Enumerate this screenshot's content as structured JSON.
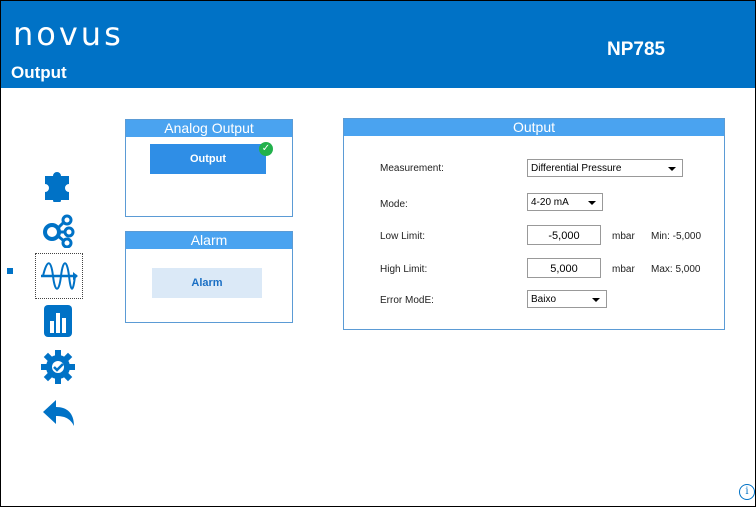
{
  "header": {
    "logo": "novus",
    "model": "NP785",
    "screen_title": "Output"
  },
  "sidebar": {
    "items": [
      {
        "icon": "puzzle-icon"
      },
      {
        "icon": "share-network-icon"
      },
      {
        "icon": "waveform-icon",
        "active": true
      },
      {
        "icon": "bar-chart-icon"
      },
      {
        "icon": "gear-check-icon"
      },
      {
        "icon": "back-arrow-icon"
      }
    ],
    "accent_color": "#0072C6"
  },
  "analog_output_card": {
    "title": "Analog Output",
    "button_label": "Output",
    "status": "check"
  },
  "alarm_card": {
    "title": "Alarm",
    "button_label": "Alarm"
  },
  "output_panel": {
    "title": "Output",
    "measurement": {
      "label": "Measurement:",
      "value": "Differential Pressure"
    },
    "mode": {
      "label": "Mode:",
      "value": "4-20 mA"
    },
    "low_limit": {
      "label": "Low Limit:",
      "value": "-5,000",
      "unit": "mbar",
      "note": "Min: -5,000"
    },
    "high_limit": {
      "label": "High Limit:",
      "value": "5,000",
      "unit": "mbar",
      "note": "Max: 5,000"
    },
    "error_mode": {
      "label": "Error ModE:",
      "value": "Baixo"
    }
  },
  "info": "i",
  "colors": {
    "header": "#0072C6",
    "card_title": "#4aa3f0",
    "success": "#22b14c"
  }
}
